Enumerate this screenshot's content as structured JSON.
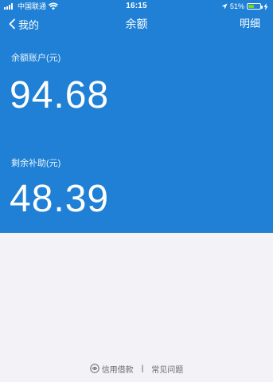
{
  "status": {
    "carrier": "中国联通",
    "time": "16:15",
    "battery_percent": "51%",
    "battery_level": 0.51,
    "battery_color": "#7ed321"
  },
  "nav": {
    "back_label": "我的",
    "title": "余额",
    "right_label": "明细"
  },
  "balance": {
    "label": "余额账户(元)",
    "amount": "94.68"
  },
  "subsidy": {
    "label": "剩余补助(元)",
    "amount": "48.39"
  },
  "footer": {
    "credit_label": "信用借款",
    "separator": "|",
    "faq_label": "常见问题"
  },
  "colors": {
    "hero_background": "#1f80d5",
    "page_background": "#f2f2f7"
  }
}
